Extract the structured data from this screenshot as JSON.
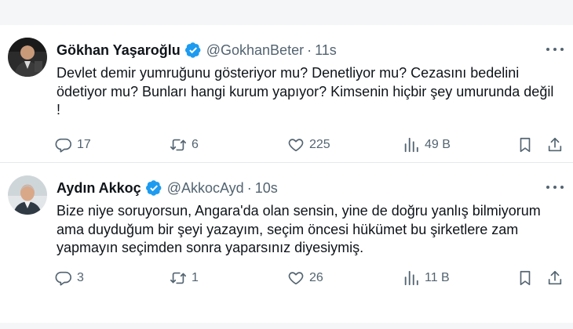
{
  "tweets": [
    {
      "name": "Gökhan Yaşaroğlu",
      "handle": "@GokhanBeter",
      "separator": "·",
      "time": "11s",
      "text": "Devlet demir yumruğunu gösteriyor mu? Denetliyor mu? Cezasını bedelini ödetiyor mu? Bunları hangi kurum yapıyor? Kimsenin hiçbir şey umurunda değil !",
      "stats": {
        "replies": "17",
        "retweets": "6",
        "likes": "225",
        "views": "49 B"
      }
    },
    {
      "name": "Aydın Akkoç",
      "handle": "@AkkocAyd",
      "separator": "·",
      "time": "10s",
      "text": "Bize niye soruyorsun, Angara'da olan sensin, yine de doğru yanlış bilmiyorum ama duyduğum bir şeyi yazayım, seçim öncesi hükümet bu şirketlere zam yapmayın seçimden sonra yaparsınız diyesiymiş.",
      "stats": {
        "replies": "3",
        "retweets": "1",
        "likes": "26",
        "views": "11 B"
      }
    }
  ],
  "colors": {
    "verified": "#1d9bf0",
    "secondary_text": "#536471",
    "primary_text": "#0f1419"
  },
  "icons": [
    "verified-badge-icon",
    "more-icon",
    "reply-icon",
    "retweet-icon",
    "like-icon",
    "views-icon",
    "bookmark-icon",
    "share-icon"
  ]
}
